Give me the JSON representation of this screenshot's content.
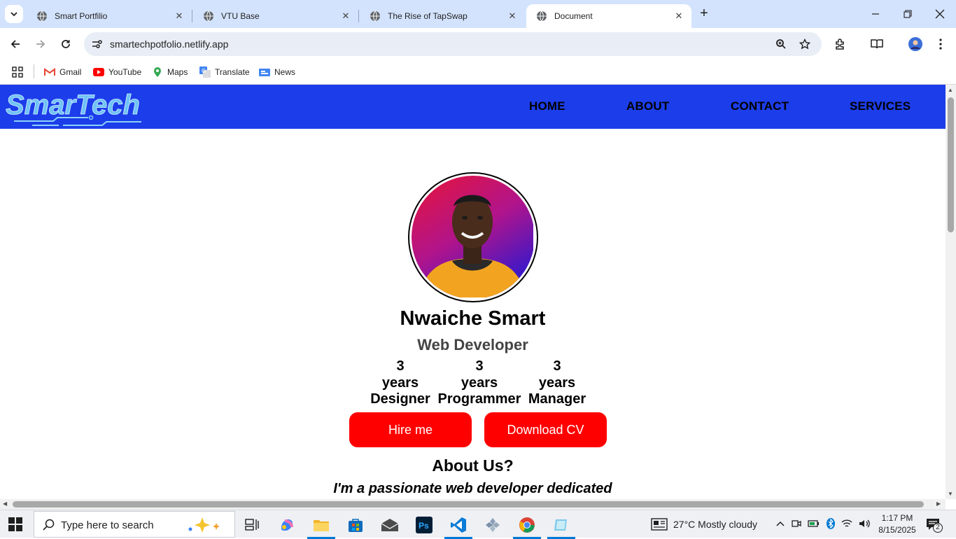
{
  "browser": {
    "tabs": [
      {
        "title": "Smart Portfilio",
        "active": false
      },
      {
        "title": "VTU Base",
        "active": false
      },
      {
        "title": "The Rise of TapSwap",
        "active": false
      },
      {
        "title": "Document",
        "active": true
      }
    ],
    "url": "smartechpotfolio.netlify.app",
    "bookmarks": [
      "Gmail",
      "YouTube",
      "Maps",
      "Translate",
      "News"
    ]
  },
  "site": {
    "logo_text": "SmarTech",
    "nav": [
      "HOME",
      "ABOUT",
      "CONTACT",
      "SERVICES"
    ],
    "name": "Nwaiche Smart",
    "role": "Web Developer",
    "stats": [
      {
        "number": "3",
        "unit": "years",
        "label": "Designer"
      },
      {
        "number": "3",
        "unit": "years",
        "label": "Programmer"
      },
      {
        "number": "3",
        "unit": "years",
        "label": "Manager"
      }
    ],
    "buttons": {
      "hire": "Hire me",
      "cv": "Download CV"
    },
    "about_title": "About Us?",
    "about_text": "I'm a passionate web developer dedicated",
    "colors": {
      "nav_bg": "#1c3dea",
      "button_bg": "#ff0000",
      "logo": "#6fc3f5"
    }
  },
  "taskbar": {
    "search_placeholder": "Type here to search",
    "weather": "27°C  Mostly cloudy",
    "time": "1:17 PM",
    "date": "8/15/2025",
    "notification_count": "2"
  }
}
